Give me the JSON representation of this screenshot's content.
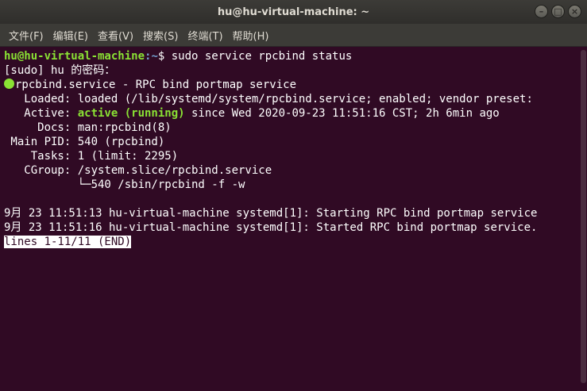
{
  "window": {
    "title": "hu@hu-virtual-machine: ~",
    "minimize": "–",
    "maximize": "□",
    "close": "×"
  },
  "menubar": {
    "items": [
      "文件(F)",
      "编辑(E)",
      "查看(V)",
      "搜索(S)",
      "终端(T)",
      "帮助(H)"
    ]
  },
  "terminal": {
    "prompt_user": "hu@hu-virtual-machine",
    "prompt_path": ":~",
    "prompt_symbol": "$ ",
    "command": "sudo service rpcbind status",
    "sudo_prompt": "[sudo] hu 的密码：",
    "service_name": "rpcbind.service - RPC bind portmap service",
    "loaded": "   Loaded: loaded (/lib/systemd/system/rpcbind.service; enabled; vendor preset:",
    "active_label": "   Active: ",
    "active_state": "active (running)",
    "active_rest": " since Wed 2020-09-23 11:51:16 CST; 2h 6min ago",
    "docs": "     Docs: man:rpcbind(8)",
    "main_pid": " Main PID: 540 (rpcbind)",
    "tasks": "    Tasks: 1 (limit: 2295)",
    "cgroup": "   CGroup: /system.slice/rpcbind.service",
    "cgroup_child": "           └─540 /sbin/rpcbind -f -w",
    "log1": "9月 23 11:51:13 hu-virtual-machine systemd[1]: Starting RPC bind portmap service",
    "log2": "9月 23 11:51:16 hu-virtual-machine systemd[1]: Started RPC bind portmap service.",
    "pager_status": "lines 1-11/11 (END)"
  },
  "colors": {
    "terminal_bg": "#300a24",
    "prompt_green": "#8ae234",
    "prompt_blue": "#729fcf",
    "titlebar": "#3c3b37"
  }
}
